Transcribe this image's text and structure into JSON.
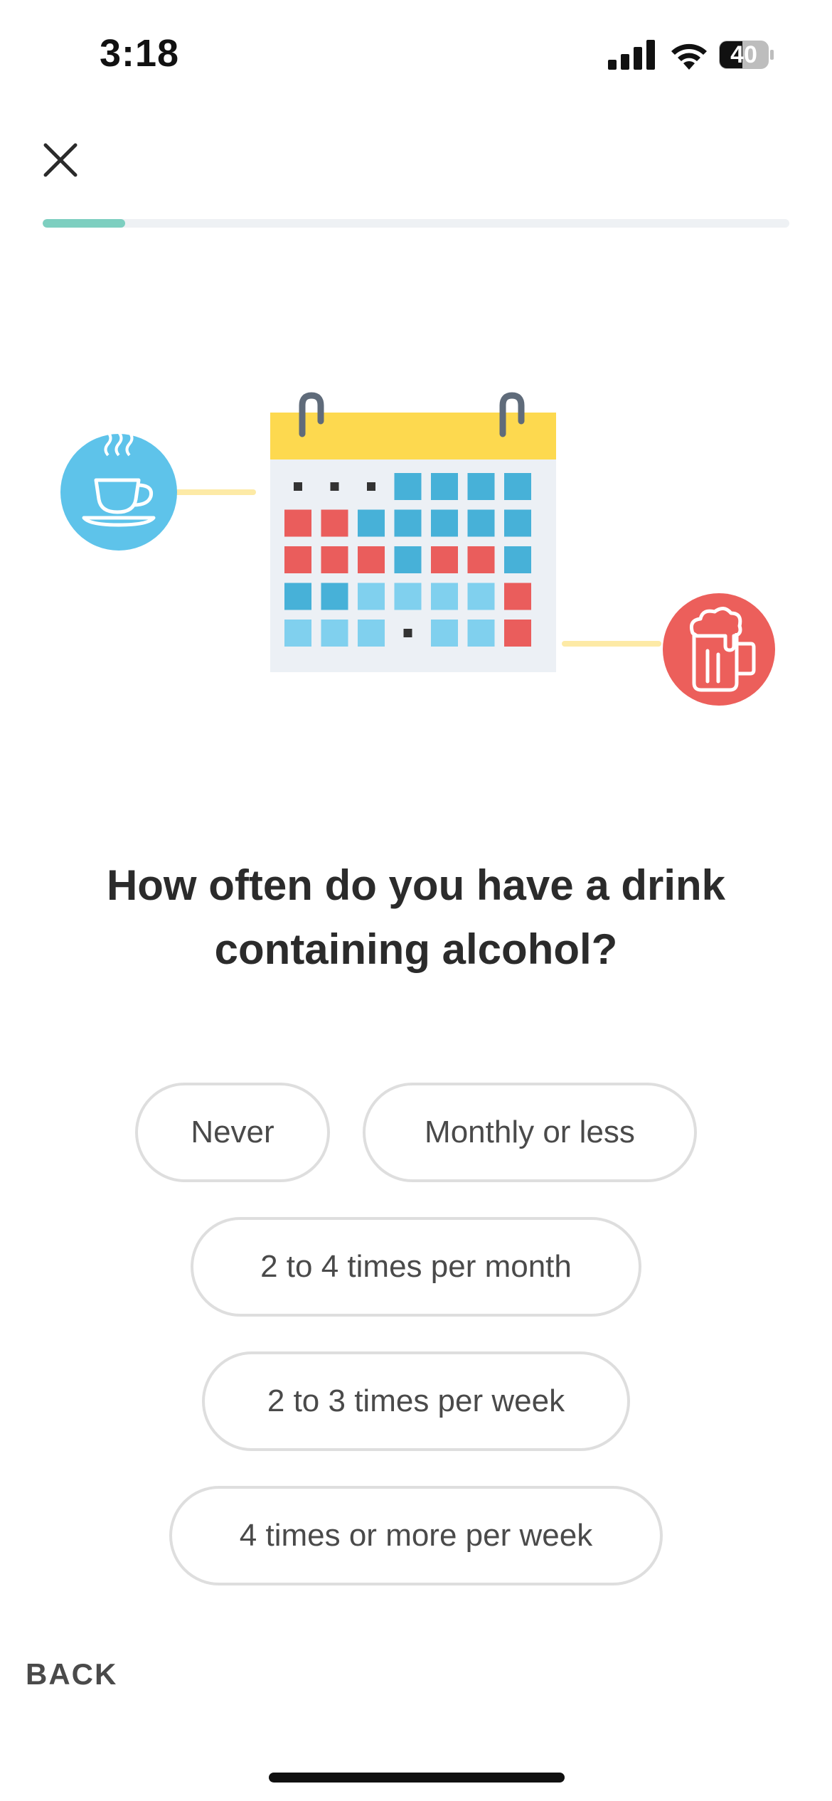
{
  "status_bar": {
    "time": "3:18",
    "battery": "40"
  },
  "progress": {
    "fraction": 0.11,
    "track_color": "#eef1f4",
    "fill_color": "#7dcfc0"
  },
  "illustration": {
    "left_icon": "coffee-cup-icon",
    "left_icon_color": "#5ec3ea",
    "right_icon": "beer-mug-icon",
    "right_icon_color": "#ec5f5b",
    "calendar_header_color": "#fdd94f",
    "connector_color": "#fdeaa6",
    "calendar_rows": [
      [
        "dot",
        "dot",
        "dot",
        "blue",
        "blue",
        "blue",
        "blue"
      ],
      [
        "red",
        "red",
        "blue",
        "blue",
        "blue",
        "blue",
        "blue"
      ],
      [
        "red",
        "red",
        "red",
        "blue",
        "red",
        "red",
        "blue"
      ],
      [
        "blue",
        "blue",
        "light",
        "light",
        "light",
        "light",
        "red"
      ],
      [
        "light",
        "light",
        "light",
        "dot",
        "light",
        "light",
        "red"
      ]
    ],
    "cell_colors": {
      "blue": "#47b1d8",
      "red": "#ea5d5c",
      "light": "#80d0ee",
      "dot": "#333333"
    }
  },
  "question": "How often do you have a drink containing alcohol?",
  "options": [
    "Never",
    "Monthly or less",
    "2 to 4 times per month",
    "2 to 3 times per week",
    "4 times or more per week"
  ],
  "back_label": "BACK"
}
